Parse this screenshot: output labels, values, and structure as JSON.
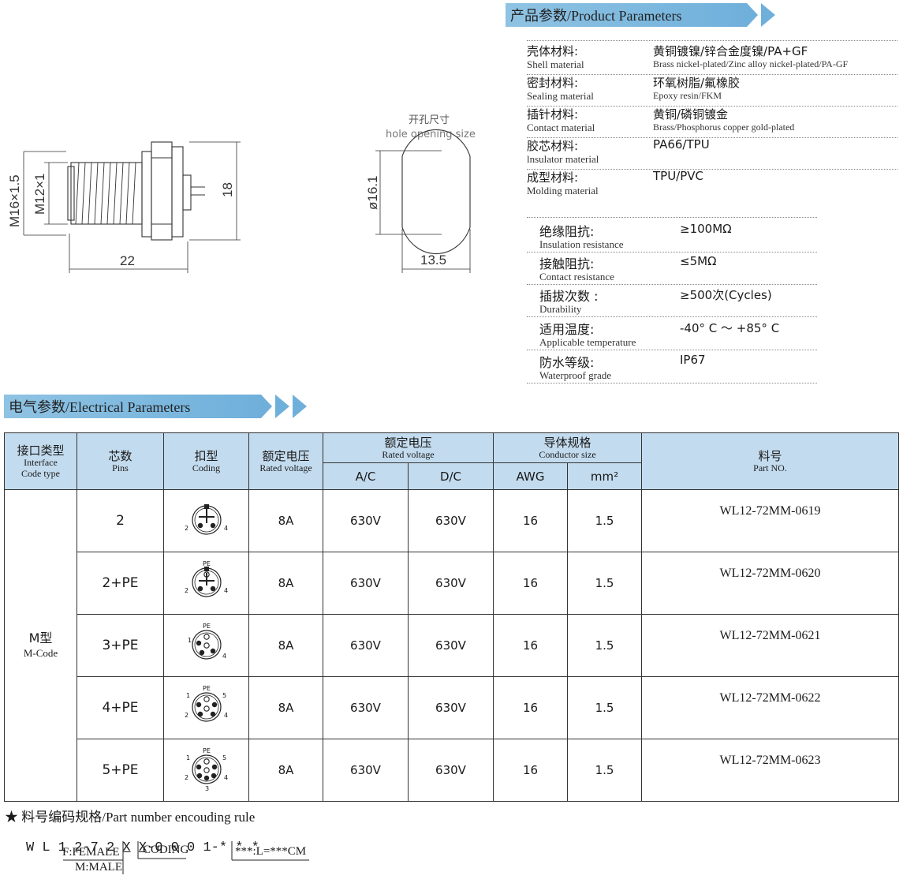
{
  "drawing": {
    "dim_m16": "M16×1.5",
    "dim_m12": "M12×1",
    "dim_22": "22",
    "dim_18": "18",
    "hole_cn": "开孔尺寸",
    "hole_en": "hole opening size",
    "dim_161": "ø16.1",
    "dim_135": "13.5"
  },
  "product": {
    "banner": "产品参数/Product Parameters",
    "rows": [
      {
        "label_cn": "壳体材料:",
        "label_en": "Shell material",
        "value_cn": "黄铜镀镍/锌合金度镍/PA+GF",
        "value_en": "Brass nickel-plated/Zinc alloy nickel-plated/PA-GF"
      },
      {
        "label_cn": "密封材料:",
        "label_en": "Sealing material",
        "value_cn": "环氧树脂/氟橡胶",
        "value_en": "Epoxy resin/FKM"
      },
      {
        "label_cn": "插针材料:",
        "label_en": "Contact material",
        "value_cn": "黄铜/磷铜镀金",
        "value_en": "Brass/Phosphorus copper gold-plated"
      },
      {
        "label_cn": "胶芯材料:",
        "label_en": "lnsulator material",
        "value_cn": "PA66/TPU",
        "value_en": ""
      },
      {
        "label_cn": "成型材料:",
        "label_en": "Molding material",
        "value_cn": "TPU/PVC",
        "value_en": ""
      }
    ],
    "specs": [
      {
        "label_cn": "绝缘阻抗:",
        "label_en": "Insulation resistance",
        "value": "≥100MΩ"
      },
      {
        "label_cn": "接触阻抗:",
        "label_en": "Contact resistance",
        "value": "≤5MΩ"
      },
      {
        "label_cn": "插拔次数 :",
        "label_en": "Durability",
        "value": "≥500次(Cycles)"
      },
      {
        "label_cn": "适用温度:",
        "label_en": "Applicable temperature",
        "value": "-40° C ～ +85° C"
      },
      {
        "label_cn": "防水等级:",
        "label_en": "Waterproof grade",
        "value": "IP67"
      }
    ]
  },
  "electrical": {
    "banner": "电气参数/Electrical Parameters",
    "headers": {
      "interface_cn": "接口类型",
      "interface_en1": "Interface",
      "interface_en2": "Code type",
      "pins_cn": "芯数",
      "pins_en": "Pins",
      "coding_cn": "扣型",
      "coding_en": "Coding",
      "current_cn": "额定电压",
      "current_en": "Rated voltage",
      "voltage_cn": "额定电压",
      "voltage_en": "Rated voltage",
      "ac": "A/C",
      "dc": "D/C",
      "conductor_cn": "导体规格",
      "conductor_en": "Conductor size",
      "awg": "AWG",
      "mm2": "mm²",
      "part_cn": "料号",
      "part_en": "Part NO."
    },
    "interface_cn": "M型",
    "interface_en": "M-Code",
    "rows": [
      {
        "pins": "2",
        "current": "8A",
        "ac": "630V",
        "dc": "630V",
        "awg": "16",
        "mm2": "1.5",
        "part": "WL12-72MM-0619"
      },
      {
        "pins": "2+PE",
        "current": "8A",
        "ac": "630V",
        "dc": "630V",
        "awg": "16",
        "mm2": "1.5",
        "part": "WL12-72MM-0620"
      },
      {
        "pins": "3+PE",
        "current": "8A",
        "ac": "630V",
        "dc": "630V",
        "awg": "16",
        "mm2": "1.5",
        "part": "WL12-72MM-0621"
      },
      {
        "pins": "4+PE",
        "current": "8A",
        "ac": "630V",
        "dc": "630V",
        "awg": "16",
        "mm2": "1.5",
        "part": "WL12-72MM-0622"
      },
      {
        "pins": "5+PE",
        "current": "8A",
        "ac": "630V",
        "dc": "630V",
        "awg": "16",
        "mm2": "1.5",
        "part": "WL12-72MM-0623"
      }
    ],
    "pin_labels": {
      "pe": "PE",
      "p1": "1",
      "p2": "2",
      "p3": "3",
      "p4": "4",
      "p5": "5"
    }
  },
  "rule": {
    "title": "★ 料号编码规格/Part number encouding rule",
    "code_a": "W L 1 2-7 2 ",
    "code_x1": "X",
    "code_b": " ",
    "code_x2": "X",
    "code_c": "-0 0 0 1-",
    "code_d": "* * *",
    "female": "F:FEMALE",
    "male": "M:MALE",
    "coding": "CODING",
    "length": "***:L=***CM"
  }
}
